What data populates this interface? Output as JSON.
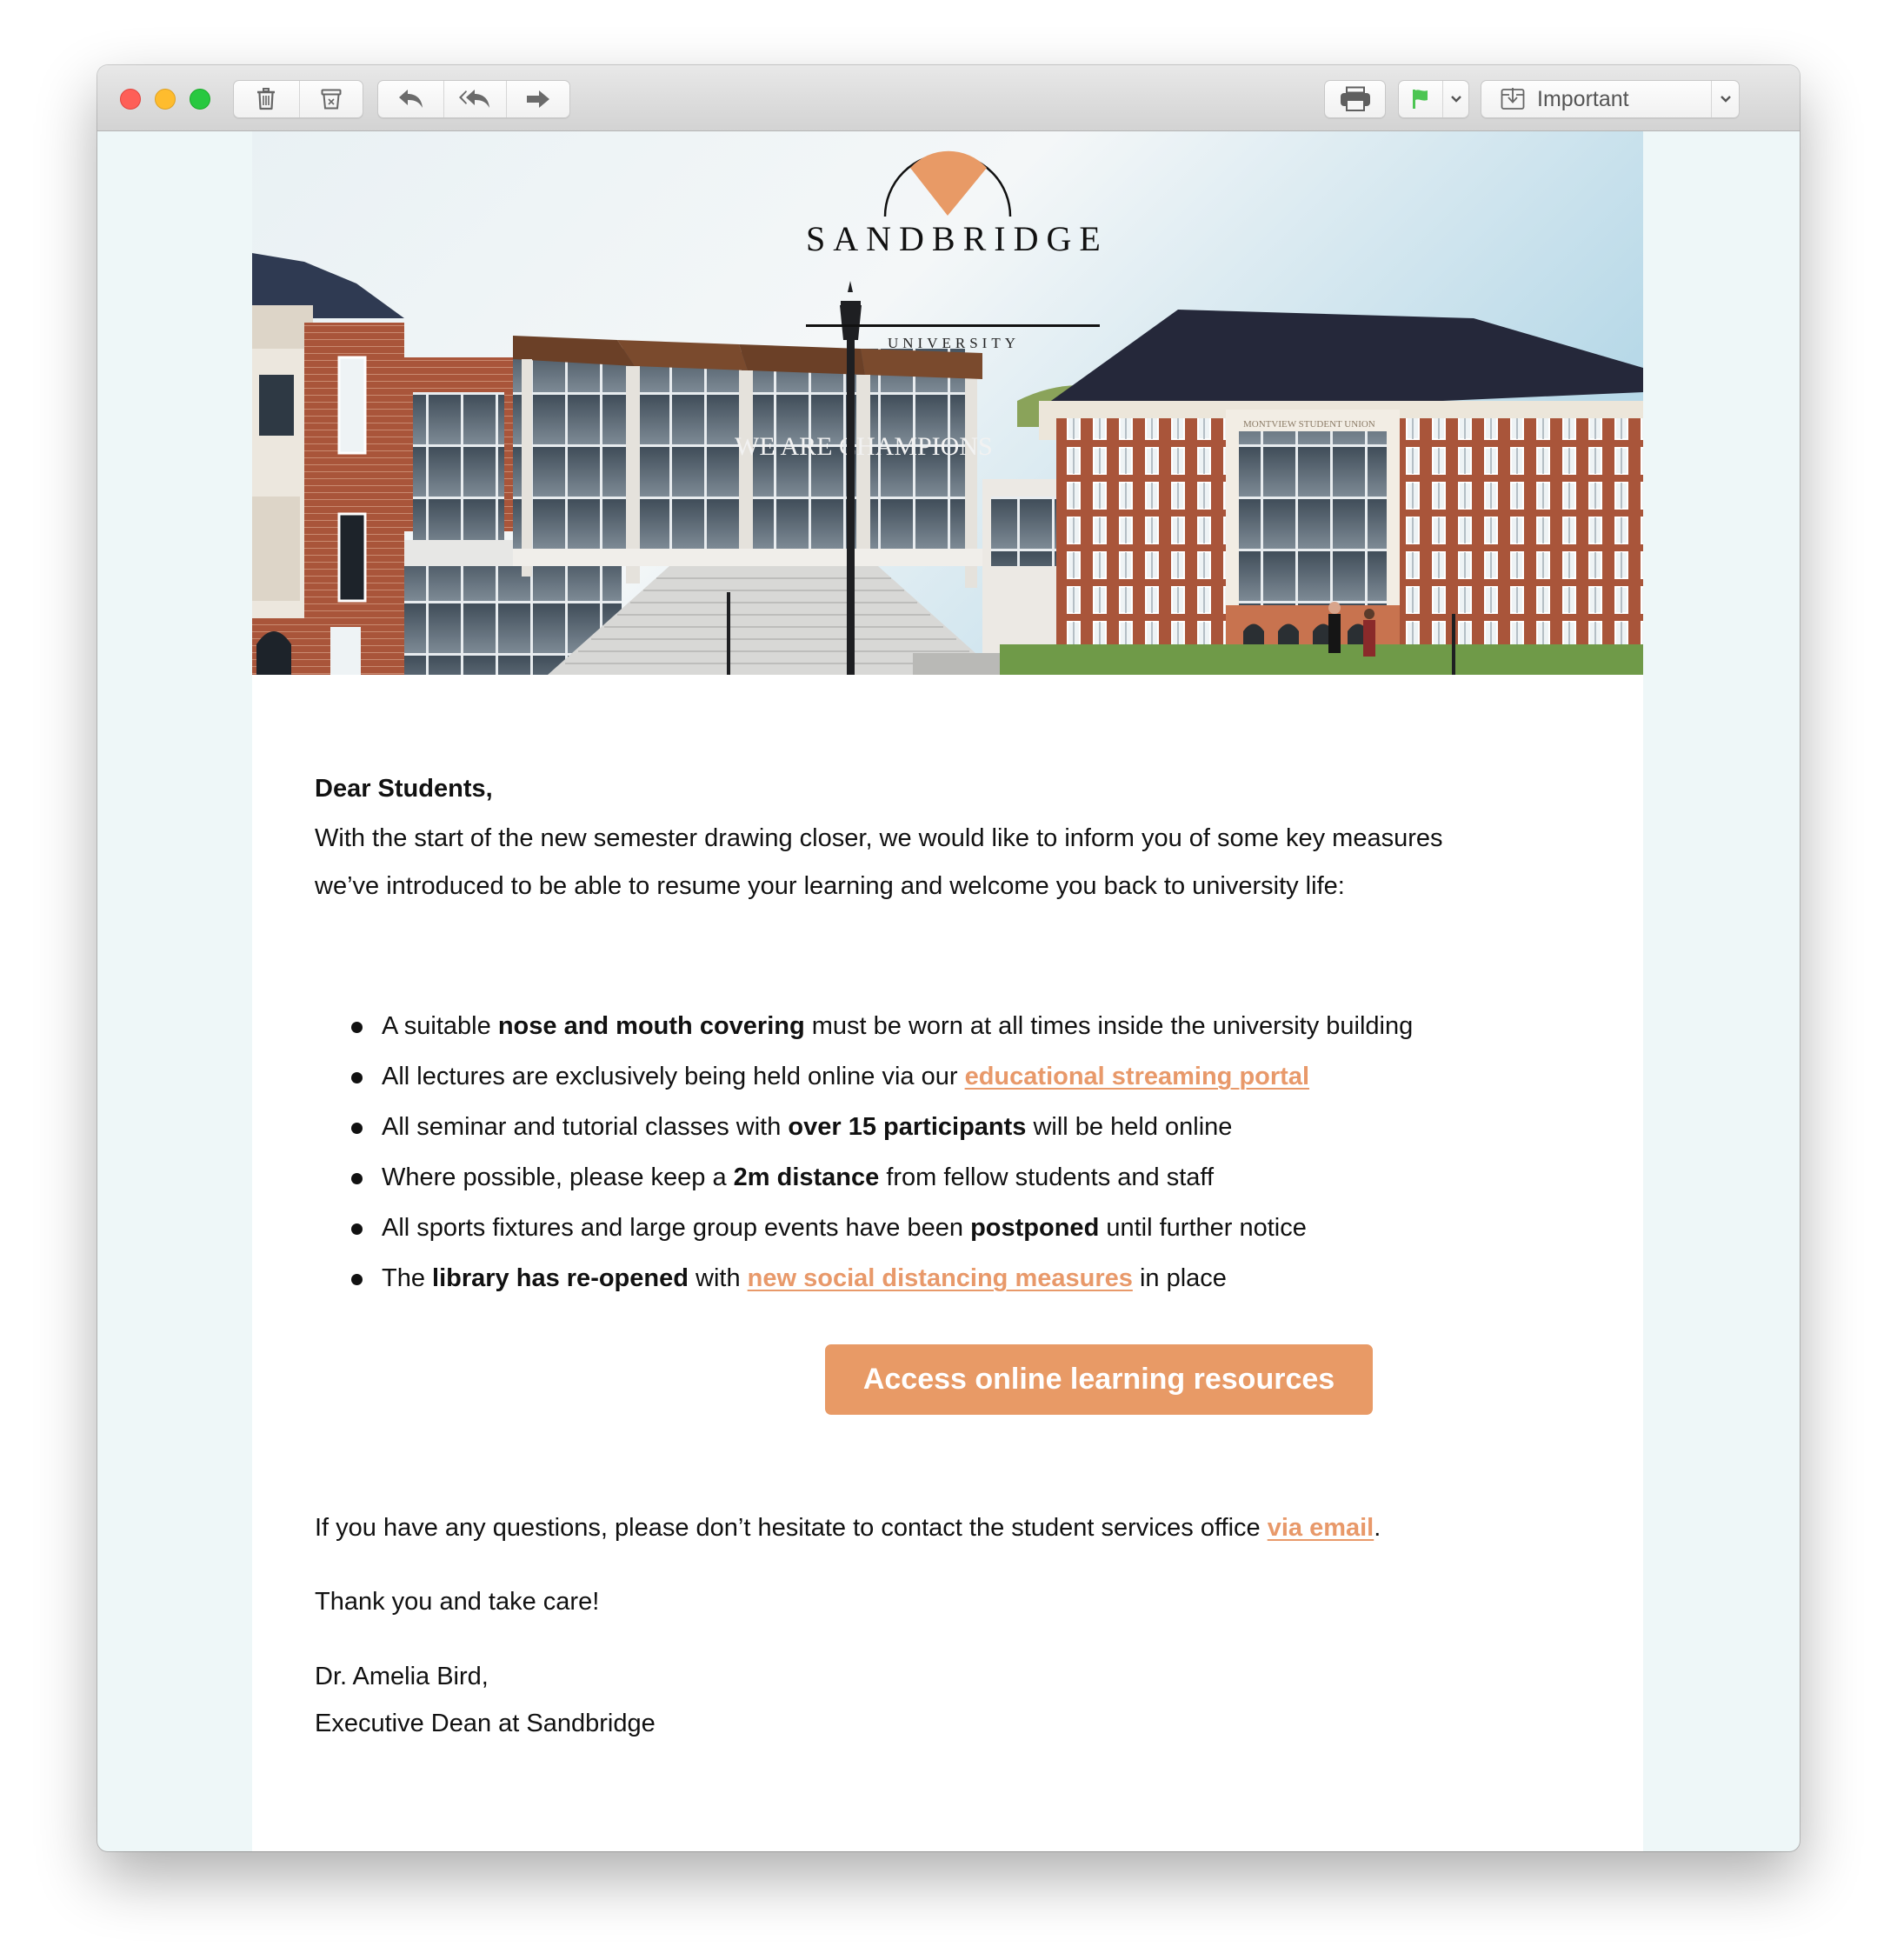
{
  "window": {
    "controls": [
      "close",
      "minimize",
      "zoom"
    ]
  },
  "toolbar": {
    "left_groups": [
      {
        "buttons": [
          {
            "icon": "trash-icon",
            "label": "Delete"
          },
          {
            "icon": "archive-icon",
            "label": "Junk"
          }
        ]
      },
      {
        "buttons": [
          {
            "icon": "reply-icon",
            "label": "Reply"
          },
          {
            "icon": "reply-all-icon",
            "label": "Reply All"
          },
          {
            "icon": "forward-icon",
            "label": "Forward"
          }
        ]
      }
    ],
    "print_icon": "printer-icon",
    "flag_icon": "flag-icon",
    "flag_color": "#4cc552",
    "mailbox_icon": "move-to-mailbox-icon",
    "mailbox_label": "Important"
  },
  "email": {
    "logo": {
      "name": "SANDBRIDGE",
      "subtitle": "UNIVERSITY",
      "accent_color": "#e89a66"
    },
    "hero_sign_text": "WE ARE CHAMPIONS",
    "hero_building_sign": "MONTVIEW STUDENT UNION",
    "greeting": "Dear Students,",
    "intro_line1": "With the start of the new semester drawing closer, we would like to inform you of some key measures",
    "intro_line2": "we’ve introduced to be able to resume your learning and welcome you back to university life:",
    "bullets": [
      {
        "pre": "A suitable ",
        "bold": "nose and mouth covering",
        "post": " must be worn at all times inside the university building"
      },
      {
        "pre": "All lectures are exclusively being held online via our ",
        "link": "educational streaming portal",
        "post": ""
      },
      {
        "pre": "All seminar and tutorial classes with ",
        "bold": "over 15 participants",
        "post": " will be held online"
      },
      {
        "pre": "Where possible, please keep a ",
        "bold": "2m distance",
        "post": " from fellow students and staff"
      },
      {
        "pre": "All sports fixtures and large group events have been ",
        "bold": "postponed",
        "post": " until further notice"
      },
      {
        "pre": "The ",
        "bold": "library has re-opened",
        "mid": " with ",
        "link": "new social distancing measures",
        "post": " in place"
      }
    ],
    "cta_label": "Access online learning resources",
    "closing_pre": "If you have any questions, please don’t hesitate to contact the student services office ",
    "closing_link": "via email",
    "closing_post": ".",
    "thanks": "Thank you and take care!",
    "signature_name": "Dr. Amelia Bird,",
    "signature_title": "Executive Dean at Sandbridge",
    "link_color": "#e8996a",
    "cta_color": "#e89a66"
  }
}
